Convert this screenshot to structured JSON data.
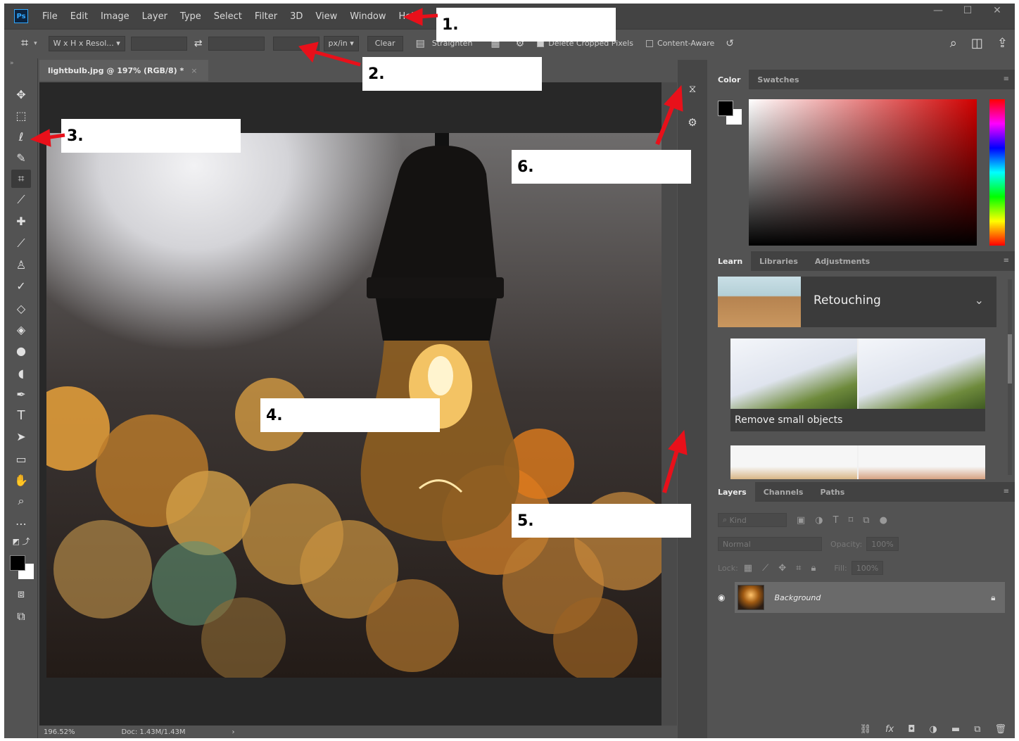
{
  "app": {
    "logo": "Ps",
    "window_controls": [
      "—",
      "☐",
      "✕"
    ]
  },
  "menu": [
    "File",
    "Edit",
    "Image",
    "Layer",
    "Type",
    "Select",
    "Filter",
    "3D",
    "View",
    "Window",
    "Help"
  ],
  "options_bar": {
    "ratio_select": "W x H x Resol...",
    "units_select": "px/in",
    "clear_button": "Clear",
    "straighten_label": "Straighten",
    "delete_cropped_label": "Delete Cropped Pixels",
    "content_aware_label": "Content-Aware"
  },
  "document": {
    "tab_title": "lightbulb.jpg @ 197% (RGB/8) *",
    "tab_close": "×"
  },
  "status": {
    "zoom": "196.52%",
    "doc_info": "Doc: 1.43M/1.43M",
    "arrow": "›"
  },
  "color_panel": {
    "tabs": [
      "Color",
      "Swatches"
    ]
  },
  "learn_panel": {
    "tabs": [
      "Learn",
      "Libraries",
      "Adjustments"
    ],
    "topic": "Retouching",
    "tutorial_label": "Remove small objects"
  },
  "layers_panel": {
    "tabs": [
      "Layers",
      "Channels",
      "Paths"
    ],
    "filter_placeholder": "Kind",
    "blend_mode": "Normal",
    "opacity_label": "Opacity:",
    "opacity_value": "100%",
    "lock_label": "Lock:",
    "fill_label": "Fill:",
    "fill_value": "100%",
    "layer_name": "Background"
  },
  "callouts": [
    "1.",
    "2.",
    "3.",
    "4.",
    "5.",
    "6."
  ],
  "colors": {
    "panel_bg": "#535353",
    "menubar_bg": "#434343",
    "accent_red": "#e8101a",
    "ps_blue": "#31a8ff"
  }
}
